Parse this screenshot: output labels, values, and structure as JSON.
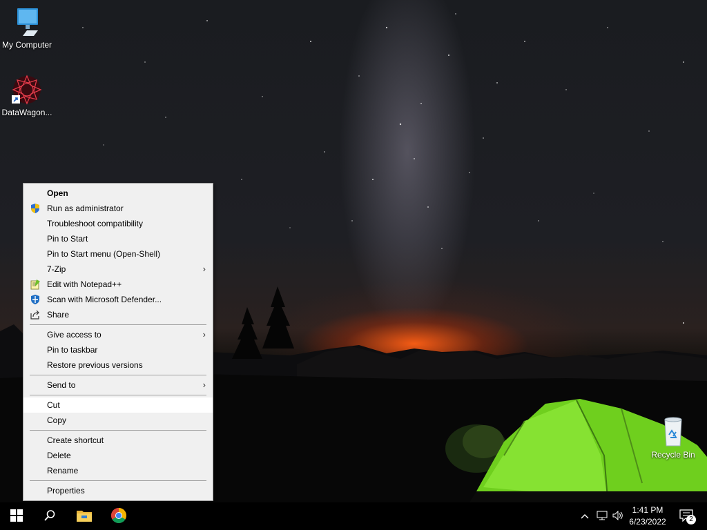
{
  "desktop": {
    "icons": [
      {
        "label": "My Computer",
        "icon": "computer-icon"
      },
      {
        "label": "DataWagon...",
        "icon": "datawagon-shortcut-icon"
      },
      {
        "label": "Recycle Bin",
        "icon": "recycle-bin-icon"
      }
    ]
  },
  "context_menu": {
    "items": [
      {
        "label": "Open",
        "bold": true
      },
      {
        "label": "Run as administrator",
        "icon": "uac-shield-icon"
      },
      {
        "label": "Troubleshoot compatibility"
      },
      {
        "label": "Pin to Start"
      },
      {
        "label": "Pin to Start menu (Open-Shell)"
      },
      {
        "label": "7-Zip",
        "submenu": true
      },
      {
        "label": "Edit with Notepad++",
        "icon": "notepad-plus-plus-icon"
      },
      {
        "label": "Scan with Microsoft Defender...",
        "icon": "defender-icon"
      },
      {
        "label": "Share",
        "icon": "share-icon"
      },
      {
        "label": "Give access to",
        "submenu": true
      },
      {
        "label": "Pin to taskbar"
      },
      {
        "label": "Restore previous versions"
      },
      {
        "label": "Send to",
        "submenu": true
      },
      {
        "label": "Cut",
        "highlighted": true
      },
      {
        "label": "Copy"
      },
      {
        "label": "Create shortcut"
      },
      {
        "label": "Delete"
      },
      {
        "label": "Rename"
      },
      {
        "label": "Properties"
      }
    ],
    "submenu_arrow": "›"
  },
  "taskbar": {
    "pinned": [
      "start-button-icon",
      "search-icon",
      "file-explorer-icon",
      "chrome-icon"
    ],
    "tray": {
      "icons": [
        "chevron-up-icon",
        "network-icon",
        "volume-icon"
      ],
      "time": "1:41 PM",
      "date": "6/23/2022",
      "notification_count": "2"
    }
  },
  "colors": {
    "menu_bg": "#f0f0f0",
    "menu_highlight": "#ffffff",
    "taskbar_bg": "#000000",
    "tent_green": "#7fdc24"
  }
}
